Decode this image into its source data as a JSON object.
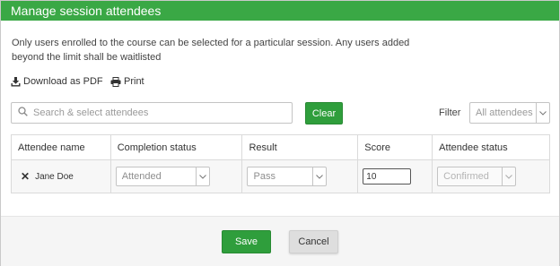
{
  "dialog": {
    "title": "Manage session attendees",
    "intro": "Only users enrolled to the course can be selected for a particular session. Any users added beyond the limit shall be waitlisted"
  },
  "actions": {
    "download_pdf": "Download as PDF",
    "print": "Print"
  },
  "search": {
    "placeholder": "Search & select attendees",
    "clear_label": "Clear"
  },
  "filter": {
    "label": "Filter",
    "selected": "All attendees"
  },
  "table": {
    "headers": [
      "Attendee name",
      "Completion status",
      "Result",
      "Score",
      "Attendee status"
    ],
    "rows": [
      {
        "name": "Jane Doe",
        "completion_status": "Attended",
        "result": "Pass",
        "score": "10",
        "attendee_status": "Confirmed"
      }
    ]
  },
  "footer": {
    "save_label": "Save",
    "cancel_label": "Cancel"
  },
  "colors": {
    "header_green": "#3aa845",
    "button_green": "#2f9e3c"
  },
  "icons": {
    "download": "download-icon",
    "print": "print-icon",
    "search": "search-icon",
    "remove": "close-icon",
    "caret": "chevron-down-icon"
  }
}
